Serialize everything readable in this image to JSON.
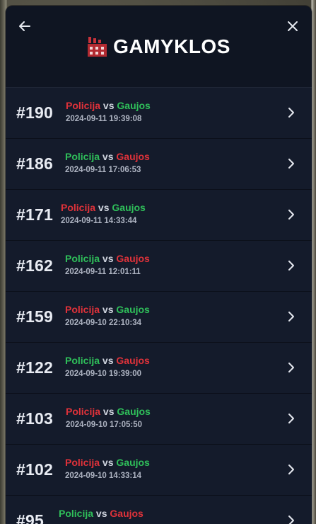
{
  "header": {
    "title": "GAMYKLOS",
    "back_icon": "arrow-left-icon",
    "close_icon": "close-icon",
    "title_icon": "factory-icon"
  },
  "colors": {
    "red_team": "#e0323a",
    "green_team": "#2fbf5a",
    "panel_bg": "#121826"
  },
  "vs_label": "vs",
  "rows": [
    {
      "number": "#190",
      "team1": "Policija",
      "team1_color": "red",
      "team2": "Gaujos",
      "team2_color": "green",
      "date": "2024-09-11 19:39:08"
    },
    {
      "number": "#186",
      "team1": "Policija",
      "team1_color": "green",
      "team2": "Gaujos",
      "team2_color": "red",
      "date": "2024-09-11 17:06:53"
    },
    {
      "number": "#171",
      "team1": "Policija",
      "team1_color": "red",
      "team2": "Gaujos",
      "team2_color": "green",
      "date": "2024-09-11 14:33:44"
    },
    {
      "number": "#162",
      "team1": "Policija",
      "team1_color": "green",
      "team2": "Gaujos",
      "team2_color": "red",
      "date": "2024-09-11 12:01:11"
    },
    {
      "number": "#159",
      "team1": "Policija",
      "team1_color": "red",
      "team2": "Gaujos",
      "team2_color": "green",
      "date": "2024-09-10 22:10:34"
    },
    {
      "number": "#122",
      "team1": "Policija",
      "team1_color": "green",
      "team2": "Gaujos",
      "team2_color": "red",
      "date": "2024-09-10 19:39:00"
    },
    {
      "number": "#103",
      "team1": "Policija",
      "team1_color": "red",
      "team2": "Gaujos",
      "team2_color": "green",
      "date": "2024-09-10 17:05:50"
    },
    {
      "number": "#102",
      "team1": "Policija",
      "team1_color": "red",
      "team2": "Gaujos",
      "team2_color": "green",
      "date": "2024-09-10 14:33:14"
    },
    {
      "number": "#95",
      "team1": "Policija",
      "team1_color": "green",
      "team2": "Gaujos",
      "team2_color": "red",
      "date": ""
    }
  ]
}
